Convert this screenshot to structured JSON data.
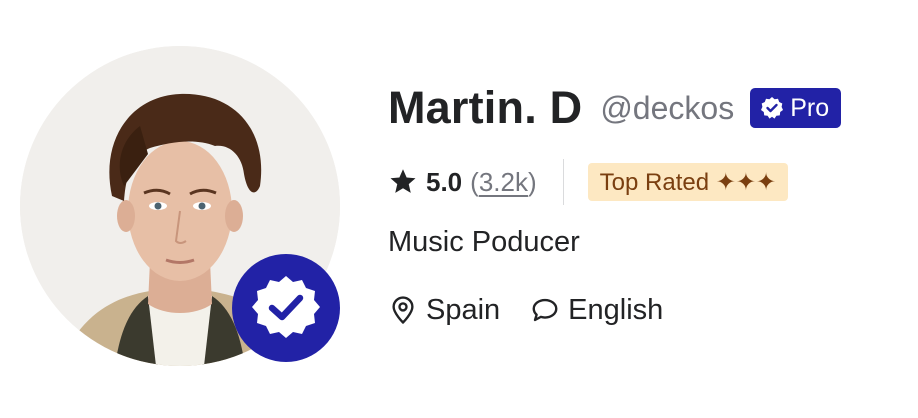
{
  "profile": {
    "display_name": "Martin. D",
    "username": "@deckos",
    "pro_label": "Pro",
    "rating": "5.0",
    "review_count": "3.2k",
    "level_label": "Top Rated ✦✦✦",
    "tagline": "Music Poducer",
    "location": "Spain",
    "language": "English"
  },
  "icons": {
    "star": "star-icon",
    "verified": "verified-check-icon",
    "location": "location-pin-icon",
    "language": "speech-bubble-icon"
  },
  "colors": {
    "pro_badge_bg": "#2222a6",
    "verified_bg": "#2222a6",
    "level_badge_bg": "#fde8c2",
    "level_badge_text": "#7a3f10",
    "muted_text": "#74767e",
    "primary_text": "#222325"
  }
}
